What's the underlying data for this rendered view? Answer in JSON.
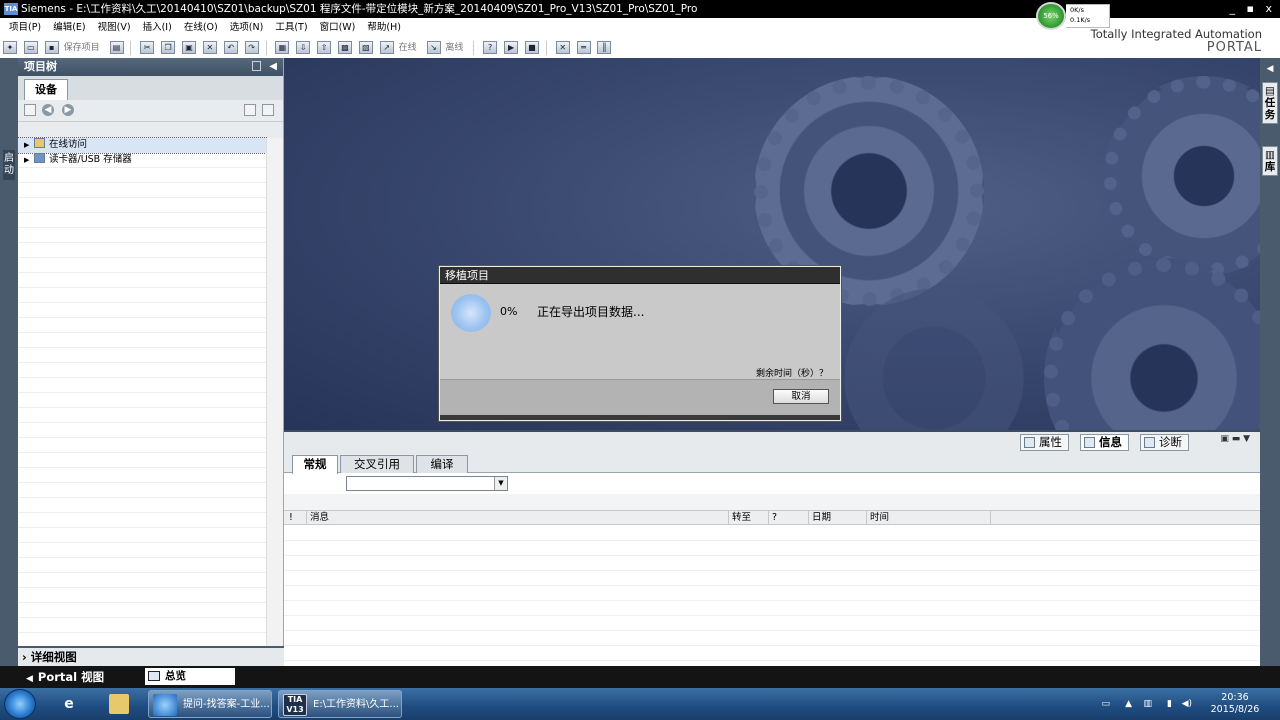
{
  "window": {
    "title": "Siemens  -  E:\\工作资料\\久工\\20140410\\SZ01\\backup\\SZ01 程序文件-带定位模块_新方案_20140409\\SZ01_Pro_V13\\SZ01_Pro\\SZ01_Pro",
    "controls": "_ ▪ x"
  },
  "net_widget": {
    "percent": "56%",
    "up": "0K/s",
    "down": "0.1K/s"
  },
  "menu": [
    "项目(P)",
    "编辑(E)",
    "视图(V)",
    "插入(I)",
    "在线(O)",
    "选项(N)",
    "工具(T)",
    "窗口(W)",
    "帮助(H)"
  ],
  "brand": {
    "line1": "Totally Integrated Automation",
    "line2": "PORTAL"
  },
  "toolbar": {
    "save_project": "保存项目",
    "go_online": "在线",
    "go_offline": "离线"
  },
  "left_rail": {
    "label": "启动"
  },
  "project_tree": {
    "header": "项目树",
    "tab": "设备",
    "items": [
      {
        "label": "在线访问",
        "selected": true
      },
      {
        "label": "读卡器/USB 存储器",
        "selected": false
      }
    ],
    "detail_view": "详细视图"
  },
  "dialog": {
    "title": "移植项目",
    "percent": "0%",
    "message": "正在导出项目数据...",
    "remaining": "剩余时间（秒）？",
    "cancel": "取消"
  },
  "right_rail": {
    "tasks": "任务",
    "libraries": "库"
  },
  "inspector": {
    "tabs": [
      {
        "label": "属性",
        "active": false
      },
      {
        "label": "信息",
        "active": true
      },
      {
        "label": "诊断",
        "active": false
      }
    ],
    "subtabs": [
      {
        "label": "常规",
        "active": true
      },
      {
        "label": "交叉引用",
        "active": false
      },
      {
        "label": "编译",
        "active": false
      }
    ],
    "columns": [
      "!",
      "消息",
      "转至",
      "?",
      "日期",
      "时间"
    ]
  },
  "portal_bar": {
    "portal_view": "Portal 视图",
    "overview": "总览"
  },
  "taskbar": {
    "tasks": [
      {
        "label": "提问-找答案-工业..."
      },
      {
        "label": "E:\\工作资料\\久工..."
      }
    ],
    "time": "20:36",
    "date": "2015/8/26"
  },
  "colors": {
    "tree_header": "#4a5b6d",
    "workspace_bg": "#36456b",
    "dialog_bg": "#c9c9c9",
    "taskbar": "#1f4c80"
  }
}
